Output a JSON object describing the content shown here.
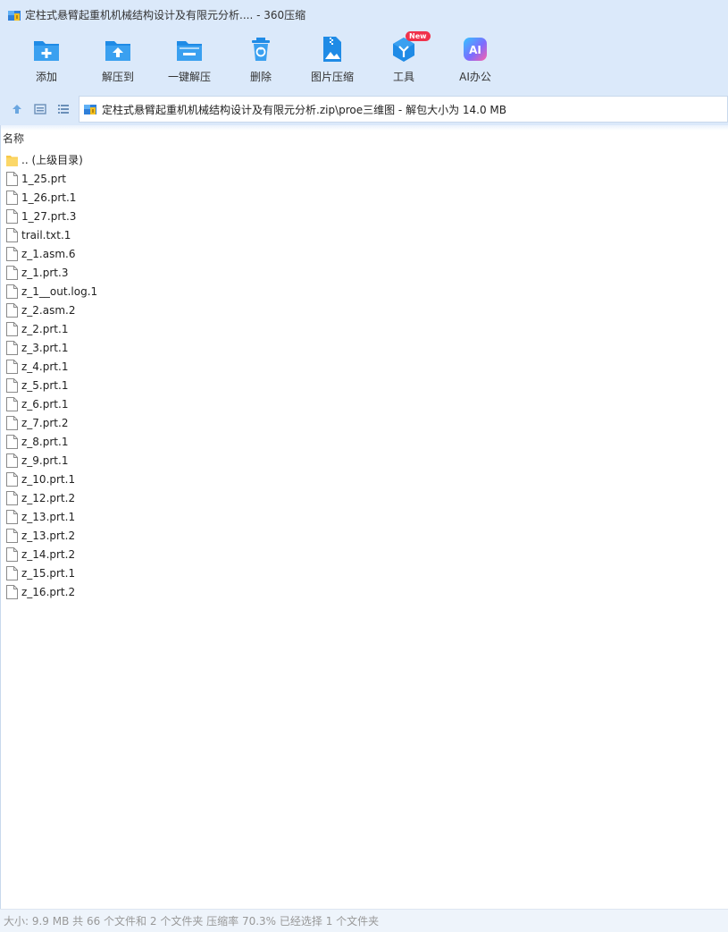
{
  "window": {
    "title": "定柱式悬臂起重机机械结构设计及有限元分析.... - 360压缩"
  },
  "toolbar": {
    "items": [
      {
        "label": "添加",
        "icon": "add-icon"
      },
      {
        "label": "解压到",
        "icon": "extract-to-icon"
      },
      {
        "label": "一键解压",
        "icon": "one-click-extract-icon"
      },
      {
        "label": "删除",
        "icon": "delete-icon"
      },
      {
        "label": "图片压缩",
        "icon": "image-compress-icon"
      },
      {
        "label": "工具",
        "icon": "tools-icon",
        "badge": "New"
      },
      {
        "label": "AI办公",
        "icon": "ai-office-icon"
      }
    ]
  },
  "address": {
    "path": "定柱式悬臂起重机机械结构设计及有限元分析.zip\\proe三维图 - 解包大小为 14.0 MB"
  },
  "list": {
    "column_name": "名称",
    "rows": [
      {
        "name": ".. (上级目录)",
        "type": "folder"
      },
      {
        "name": "1_25.prt",
        "type": "file"
      },
      {
        "name": "1_26.prt.1",
        "type": "file"
      },
      {
        "name": "1_27.prt.3",
        "type": "file"
      },
      {
        "name": "trail.txt.1",
        "type": "file"
      },
      {
        "name": "z_1.asm.6",
        "type": "file"
      },
      {
        "name": "z_1.prt.3",
        "type": "file"
      },
      {
        "name": "z_1__out.log.1",
        "type": "file"
      },
      {
        "name": "z_2.asm.2",
        "type": "file"
      },
      {
        "name": "z_2.prt.1",
        "type": "file"
      },
      {
        "name": "z_3.prt.1",
        "type": "file"
      },
      {
        "name": "z_4.prt.1",
        "type": "file"
      },
      {
        "name": "z_5.prt.1",
        "type": "file"
      },
      {
        "name": "z_6.prt.1",
        "type": "file"
      },
      {
        "name": "z_7.prt.2",
        "type": "file"
      },
      {
        "name": "z_8.prt.1",
        "type": "file"
      },
      {
        "name": "z_9.prt.1",
        "type": "file"
      },
      {
        "name": "z_10.prt.1",
        "type": "file"
      },
      {
        "name": "z_12.prt.2",
        "type": "file"
      },
      {
        "name": "z_13.prt.1",
        "type": "file"
      },
      {
        "name": "z_13.prt.2",
        "type": "file"
      },
      {
        "name": "z_14.prt.2",
        "type": "file"
      },
      {
        "name": "z_15.prt.1",
        "type": "file"
      },
      {
        "name": "z_16.prt.2",
        "type": "file"
      }
    ]
  },
  "status": {
    "text": "大小: 9.9 MB 共 66 个文件和 2 个文件夹 压缩率 70.3% 已经选择 1 个文件夹"
  },
  "colors": {
    "chrome_bg": "#dbe9fa",
    "accent_blue": "#1f8be6",
    "folder_yellow": "#f8c949"
  }
}
